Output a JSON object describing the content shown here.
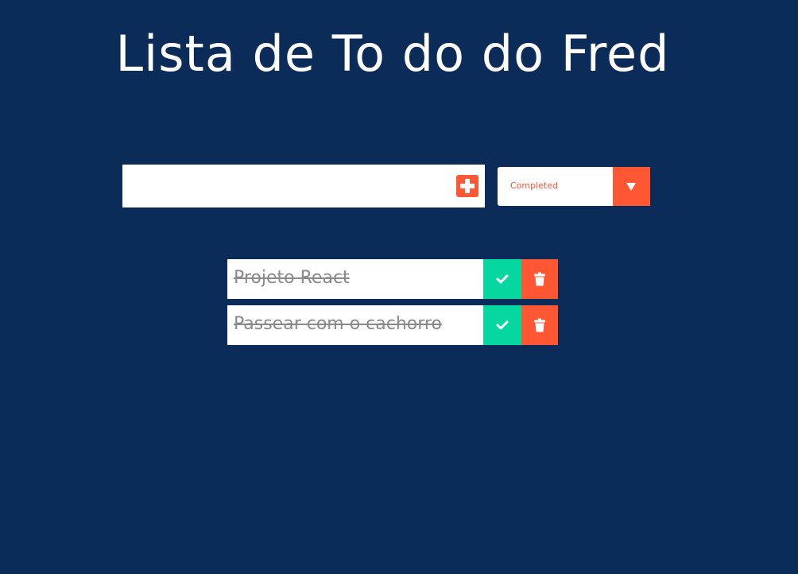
{
  "header": {
    "title": "Lista de To do do Fred"
  },
  "form": {
    "input_value": "",
    "input_placeholder": "",
    "add_icon": "plus-square-icon",
    "filter": {
      "selected": "Completed",
      "arrow_icon": "caret-down-icon"
    }
  },
  "todos": [
    {
      "text": "Projeto React",
      "completed": true
    },
    {
      "text": "Passear com o cachorro",
      "completed": true
    }
  ],
  "colors": {
    "background": "#0b2c59",
    "accent": "#ff5733",
    "complete": "#06d6a0",
    "completed_text": "#8a8a8a"
  }
}
